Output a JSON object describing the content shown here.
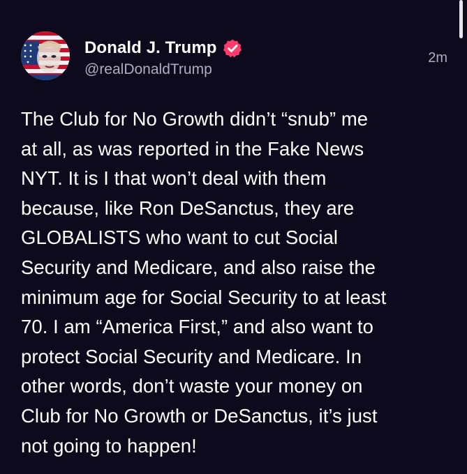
{
  "post": {
    "author": {
      "display_name": "Donald J. Trump",
      "handle": "@realDonaldTrump",
      "verified": true,
      "avatar_icon": "flag-portrait-avatar"
    },
    "timestamp": "2m",
    "body": "The Club for No Growth didn’t “snub” me\nat all, as was reported in the Fake News\nNYT. It is I that won’t deal with them\nbecause, like Ron DeSanctus, they are\nGLOBALISTS who want to cut Social\nSecurity and Medicare, and also raise the\nminimum age for Social Security to at least\n70. I am “America First,” and also want to\nprotect Social Security and Medicare. In\nother words, don’t waste your money on\nClub for No Growth or DeSanctus, it’s just\nnot going to happen!"
  },
  "colors": {
    "background": "#0d0a1e",
    "text_primary": "#ffffff",
    "text_secondary": "#b0adc0",
    "verified_badge": "#ff3b6b"
  }
}
